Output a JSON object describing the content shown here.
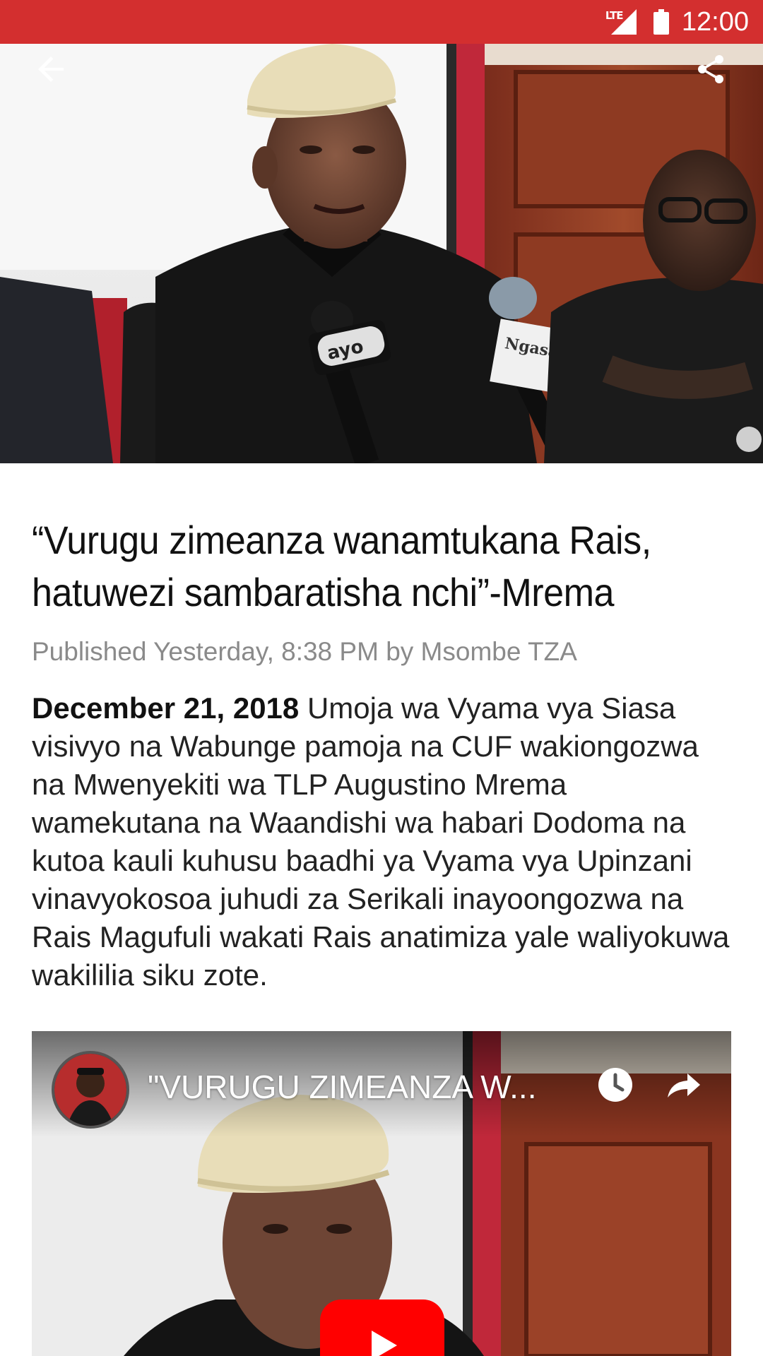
{
  "status_bar": {
    "network": "LTE",
    "time": "12:00",
    "background_color": "#d32f2f"
  },
  "hero": {
    "icons": [
      "arrow-back-icon",
      "share-icon"
    ],
    "microphone_labels": [
      "ayo",
      "NgasaTv"
    ]
  },
  "article": {
    "title": "“Vurugu zimeanza wanamtukana Rais, hatuwezi sambaratisha nchi”-Mrema",
    "meta": "Published Yesterday, 8:38 PM by Msombe TZA",
    "date": "December  21, 2018",
    "body": " Umoja wa Vyama vya Siasa visivyo na Wabunge pamoja na CUF wakiongozwa na Mwenyekiti wa TLP Augustino Mrema wamekutana na Waandishi wa habari Dodoma na kutoa kauli kuhusu baadhi ya Vyama vya Upinzani vinavyokosoa juhudi za Serikali inayoongozwa na Rais Magufuli wakati Rais anatimiza yale waliyokuwa wakililia siku zote."
  },
  "video": {
    "title": "\"VURUGU ZIMEANZA W...",
    "icons": [
      "watch-later-icon",
      "share-icon",
      "youtube-play-icon"
    ],
    "play_color": "#ff0000"
  }
}
